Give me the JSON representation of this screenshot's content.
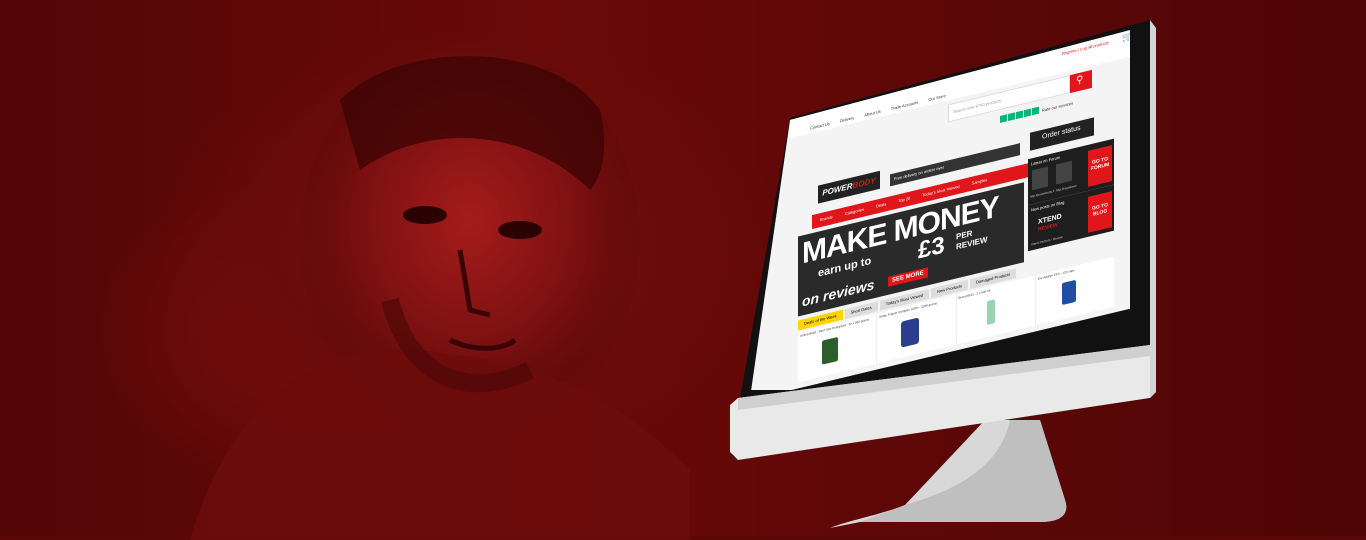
{
  "site": {
    "account": "Register | Log in",
    "basket": "0 products",
    "search_placeholder": "Search over 8700 products",
    "nav": [
      "Contact Us",
      "Delivery",
      "About Us",
      "Trade Accounts",
      "Our Store"
    ],
    "rating_text": "Rate our services",
    "order_status": "Order status",
    "free_delivery": "Free delivery on orders over",
    "menu": [
      "Brands",
      "Categories",
      "Deals",
      "Top 20",
      "Today's Most Viewed",
      "Samples"
    ],
    "banner": {
      "line1": "MAKE MONEY",
      "line2": "earn up to",
      "amount": "£3",
      "per": "PER",
      "review": "REVIEW",
      "line3": "on reviews",
      "cta": "SEE MORE"
    },
    "forum": {
      "title": "Latest on Forum",
      "cta_line1": "GO TO",
      "cta_line2": "FORUM",
      "user1": "http://powerbody.fi",
      "user2": "http://ragedown"
    },
    "blog": {
      "title": "New posts on Blog",
      "cta_line1": "GO TO",
      "cta_line2": "BLOG",
      "post_brand": "XTEND",
      "post_sub": "REVIEW",
      "post_title": "Xtend Perform - Review"
    },
    "tabs": [
      "Deals of the Week",
      "Short Dates",
      "Today's Most Viewed",
      "New Products",
      "Damaged Products"
    ],
    "products": [
      "Amino Build - Next Gen Energized - 30 x 260 grams",
      "Whey Protein Complex 100% - 2268 grams",
      "Brand BCD - 1 x 500 ml",
      "Kre-Alkalyn EFX - 120 caps"
    ]
  },
  "colors": {
    "accent": "#e0161b",
    "background": "#5a0707"
  }
}
